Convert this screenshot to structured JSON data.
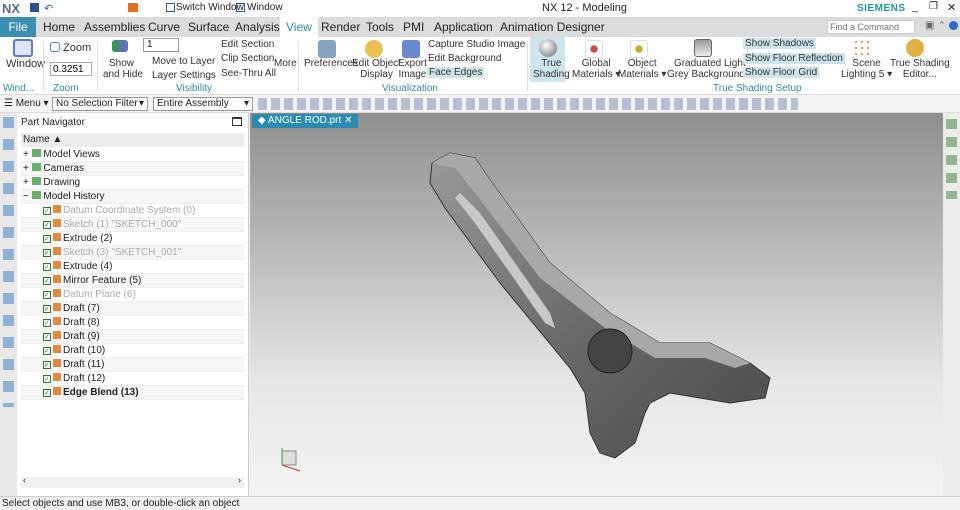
{
  "titlebar": {
    "logo": "NX",
    "switch_window": "Switch Window",
    "window_menu": "Window",
    "title": "NX 12 - Modeling",
    "brand": "SIEMENS"
  },
  "tabs": [
    "File",
    "Home",
    "Assemblies",
    "Curve",
    "Surface",
    "Analysis",
    "View",
    "Render",
    "Tools",
    "PMI",
    "Application",
    "Animation Designer"
  ],
  "search": {
    "placeholder": "Find a Command"
  },
  "ribbon": {
    "window": "Window",
    "zoom": "Zoom",
    "zoom_value": "0.3251",
    "show_hide": [
      "Show",
      "and Hide"
    ],
    "layer_value": "1",
    "move_to_layer": "Move to Layer",
    "layer_settings": "Layer Settings",
    "edit_section": "Edit Section",
    "clip_section": "Clip Section",
    "see_thru_all": "See-Thru All",
    "more": "More",
    "preferences": "Preferences",
    "edit_object_display": [
      "Edit Object",
      "Display"
    ],
    "export_image": [
      "Export",
      "Image"
    ],
    "capture_studio_image": "Capture Studio Image",
    "edit_background": "Edit Background",
    "face_edges": "Face Edges",
    "true_shading": [
      "True",
      "Shading"
    ],
    "global_materials": [
      "Global",
      "Materials"
    ],
    "object_materials": [
      "Object",
      "Materials"
    ],
    "graduated": [
      "Graduated Light",
      "Grey Background"
    ],
    "show_shadows": "Show Shadows",
    "show_floor_reflection": "Show Floor Reflection",
    "show_floor_grid": "Show Floor Grid",
    "scene_lighting": [
      "Scene",
      "Lighting 5"
    ],
    "true_shading_editor": [
      "True Shading",
      "Editor..."
    ],
    "groups": {
      "window": "Wind...",
      "zoom": "Zoom",
      "visibility": "Visibility",
      "visualization": "Visualization",
      "true_shading_setup": "True Shading Setup"
    }
  },
  "toolbar": {
    "menu": "Menu",
    "selection_filter": "No Selection Filter",
    "scope": "Entire Assembly"
  },
  "navigator": {
    "title": "Part Navigator",
    "column": "Name",
    "items": [
      {
        "label": "Model Views",
        "style": "",
        "indent": 0,
        "exp": "+"
      },
      {
        "label": "Cameras",
        "style": "",
        "indent": 0,
        "exp": "+"
      },
      {
        "label": "Drawing",
        "style": "",
        "indent": 0,
        "exp": "+"
      },
      {
        "label": "Model History",
        "style": "",
        "indent": 0,
        "exp": "−"
      },
      {
        "label": "Datum Coordinate System (0)",
        "style": "grey",
        "indent": 1
      },
      {
        "label": "Sketch (1) \"SKETCH_000\"",
        "style": "grey",
        "indent": 1
      },
      {
        "label": "Extrude (2)",
        "style": "",
        "indent": 1
      },
      {
        "label": "Sketch (3) \"SKETCH_001\"",
        "style": "grey",
        "indent": 1
      },
      {
        "label": "Extrude (4)",
        "style": "",
        "indent": 1
      },
      {
        "label": "Mirror Feature (5)",
        "style": "",
        "indent": 1
      },
      {
        "label": "Datum Plane (6)",
        "style": "grey",
        "indent": 1
      },
      {
        "label": "Draft (7)",
        "style": "",
        "indent": 1
      },
      {
        "label": "Draft (8)",
        "style": "",
        "indent": 1
      },
      {
        "label": "Draft (9)",
        "style": "",
        "indent": 1
      },
      {
        "label": "Draft (10)",
        "style": "",
        "indent": 1
      },
      {
        "label": "Draft (11)",
        "style": "",
        "indent": 1
      },
      {
        "label": "Draft (12)",
        "style": "",
        "indent": 1
      },
      {
        "label": "Edge Blend (13)",
        "style": "bold",
        "indent": 1
      }
    ]
  },
  "viewport": {
    "tab": "ANGLE ROD.prt"
  },
  "status": {
    "message": "Select objects and use MB3, or double-click an object"
  },
  "colors": {
    "accent": "#2a8ab0",
    "file_tab": "#3b8fb3",
    "highlight": "#cde6ee"
  }
}
